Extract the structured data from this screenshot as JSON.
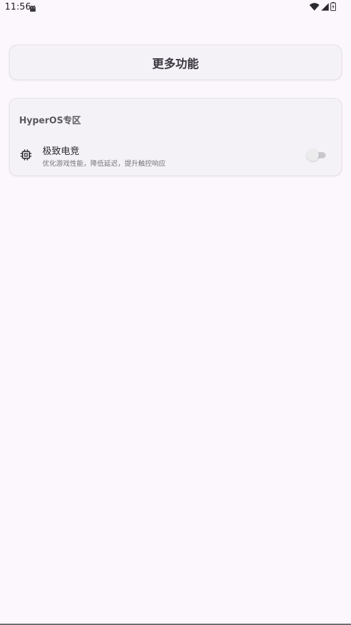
{
  "status_bar": {
    "time": "11:56",
    "icons": [
      "android-icon",
      "wifi-icon",
      "signal-icon",
      "battery-icon"
    ]
  },
  "header": {
    "title": "更多功能"
  },
  "section": {
    "title": "HyperOS专区",
    "items": [
      {
        "icon": "chip-icon",
        "label": "极致电竞",
        "description": "优化游戏性能，降低延迟，提升触控响应",
        "toggle_on": false
      }
    ]
  },
  "colors": {
    "background": "#fcf7fc",
    "card": "#f5f2f7",
    "text_primary": "#2b2930",
    "text_secondary": "#77737c"
  }
}
